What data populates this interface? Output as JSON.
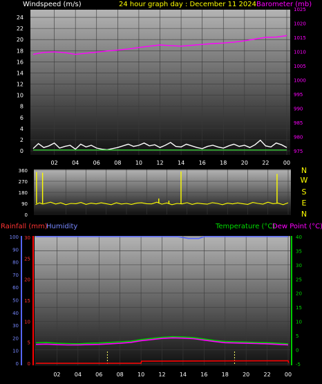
{
  "chart_data": [
    {
      "type": "line",
      "title": "24 hour graph day : December 11 2024",
      "left_axis_label": "Windspeed (m/s)",
      "right_axis_label": "Barometer (mb)",
      "x_ticks": [
        "02",
        "04",
        "06",
        "08",
        "10",
        "12",
        "14",
        "16",
        "18",
        "20",
        "22",
        "00"
      ],
      "left_ticks": [
        0,
        2,
        4,
        6,
        8,
        10,
        12,
        14,
        16,
        18,
        20,
        22,
        24
      ],
      "left_ylim": [
        0,
        25
      ],
      "right_ticks": [
        975,
        980,
        985,
        990,
        995,
        1000,
        1005,
        1010,
        1015,
        1020,
        1025
      ],
      "right_ylim": [
        974,
        1025
      ],
      "grid": true,
      "series": [
        {
          "axis": "right",
          "color": "#ff00ff",
          "x": [
            0,
            1,
            2,
            3,
            4,
            5,
            6,
            7,
            8,
            9,
            10,
            11,
            12,
            13,
            14,
            15,
            16,
            17,
            18,
            19,
            20,
            21,
            22,
            23,
            24
          ],
          "values": [
            1009.0,
            1009.7,
            1009.9,
            1009.6,
            1009.0,
            1009.4,
            1009.8,
            1010.2,
            1010.5,
            1010.9,
            1011.4,
            1011.9,
            1012.3,
            1012.1,
            1011.9,
            1012.2,
            1012.5,
            1012.8,
            1013.0,
            1013.3,
            1013.8,
            1014.4,
            1015.0,
            1015.1,
            1015.6
          ]
        },
        {
          "axis": "left",
          "color": "#ffffff",
          "x": [
            0,
            0.5,
            1,
            1.5,
            2,
            2.5,
            3,
            3.5,
            4,
            4.5,
            5,
            5.5,
            6,
            6.5,
            7,
            7.5,
            8,
            8.5,
            9,
            9.5,
            10,
            10.5,
            11,
            11.5,
            12,
            12.5,
            13,
            13.5,
            14,
            14.5,
            15,
            15.5,
            16,
            16.5,
            17,
            17.5,
            18,
            18.5,
            19,
            19.5,
            20,
            20.5,
            21,
            21.5,
            22,
            22.5,
            23,
            23.5,
            24
          ],
          "values": [
            0.4,
            1.3,
            0.6,
            0.9,
            1.4,
            0.5,
            0.8,
            1.0,
            0.3,
            1.2,
            0.7,
            1.0,
            0.5,
            0.3,
            0.2,
            0.4,
            0.6,
            0.9,
            1.2,
            0.8,
            1.0,
            1.4,
            0.9,
            1.1,
            0.6,
            1.0,
            1.5,
            0.8,
            0.7,
            1.2,
            0.9,
            0.6,
            0.4,
            0.8,
            1.0,
            0.7,
            0.5,
            0.9,
            1.2,
            0.8,
            1.0,
            0.6,
            1.1,
            1.9,
            0.9,
            0.7,
            1.4,
            1.1,
            0.6
          ]
        },
        {
          "axis": "left",
          "color": "#33cc33",
          "x": [
            0,
            24
          ],
          "values": [
            0.15,
            0.15
          ]
        }
      ]
    },
    {
      "type": "line",
      "y_ticks": [
        0,
        90,
        180,
        270,
        360
      ],
      "ylim": [
        0,
        360
      ],
      "compass_labels": [
        "N",
        "W",
        "S",
        "E",
        "N"
      ],
      "grid": true,
      "series": [
        {
          "color": "#ffff00",
          "x": [
            -1,
            -0.6,
            -0.3,
            0,
            0.5,
            1,
            1.5,
            2,
            2.5,
            3,
            3.5,
            4,
            4.5,
            5,
            5.5,
            6,
            6.5,
            7,
            7.5,
            8,
            8.5,
            9,
            9.5,
            10,
            10.5,
            11,
            11.5,
            12,
            12.5,
            13,
            13.5,
            14,
            14.5,
            15,
            15.5,
            16,
            16.5,
            17,
            17.5,
            18,
            18.5,
            19,
            19.5,
            20,
            20.5,
            21,
            21.5,
            22,
            22.5,
            23,
            23.5,
            24
          ],
          "values": [
            80,
            95,
            85,
            90,
            100,
            85,
            95,
            80,
            90,
            88,
            98,
            82,
            92,
            86,
            95,
            88,
            80,
            95,
            85,
            90,
            82,
            92,
            95,
            88,
            86,
            100,
            84,
            94,
            80,
            90,
            86,
            96,
            82,
            92,
            88,
            84,
            96,
            90,
            80,
            92,
            86,
            94,
            88,
            82,
            98,
            90,
            84,
            100,
            88,
            92,
            80,
            95
          ],
          "spikes": [
            {
              "x": -0.9,
              "value": 345
            },
            {
              "x": -0.3,
              "value": 340
            },
            {
              "x": 11.2,
              "value": 130
            },
            {
              "x": 12.2,
              "value": 112
            },
            {
              "x": 13.4,
              "value": 350
            },
            {
              "x": 22.9,
              "value": 330
            }
          ]
        }
      ]
    },
    {
      "type": "line",
      "left_label_1": "Rainfall (mm)",
      "left_label_2": "Humidity",
      "right_label_1": "Temperature (°C)",
      "right_label_2": "Dew Point (°C)",
      "x_ticks": [
        "02",
        "04",
        "06",
        "08",
        "10",
        "12",
        "14",
        "16",
        "18",
        "20",
        "22",
        "00"
      ],
      "humidity_ticks": [
        0,
        10,
        20,
        30,
        40,
        50,
        60,
        70,
        80,
        90,
        100
      ],
      "humidity_ylim": [
        0,
        100
      ],
      "rain_ticks": [
        0,
        5,
        10,
        15,
        20,
        25,
        30
      ],
      "rain_ylim": [
        0,
        30
      ],
      "temp_ticks": [
        -5,
        0,
        5,
        10,
        15,
        20,
        25,
        30,
        35,
        40
      ],
      "temp_ylim": [
        -6,
        40
      ],
      "grid": true,
      "series": [
        {
          "name": "Humidity",
          "axis": "humidity",
          "color": "#5566ff",
          "x": [
            0,
            4,
            8,
            12,
            13.5,
            14.5,
            15.5,
            16,
            20,
            24
          ],
          "values": [
            100,
            100,
            100,
            100,
            100,
            98.5,
            98.5,
            100,
            100,
            100
          ]
        },
        {
          "name": "Temperature (°C)",
          "axis": "temp",
          "color": "#00cc00",
          "x": [
            0,
            1,
            2,
            3,
            4,
            5,
            6,
            7,
            8,
            9,
            10,
            11,
            12,
            13,
            14,
            15,
            16,
            17,
            18,
            19,
            20,
            21,
            22,
            23,
            24
          ],
          "values": [
            2.5,
            2.6,
            2.3,
            2.2,
            2.1,
            2.3,
            2.4,
            2.6,
            2.8,
            3.0,
            3.6,
            4.0,
            4.4,
            4.6,
            4.5,
            4.3,
            3.8,
            3.3,
            2.9,
            2.8,
            2.7,
            2.6,
            2.5,
            2.3,
            2.1
          ]
        },
        {
          "name": "Dew Point (°C)",
          "axis": "temp",
          "color": "#ff00ff",
          "x": [
            0,
            1,
            2,
            3,
            4,
            5,
            6,
            7,
            8,
            9,
            10,
            11,
            12,
            13,
            14,
            15,
            16,
            17,
            18,
            19,
            20,
            21,
            22,
            23,
            24
          ],
          "values": [
            1.9,
            2.0,
            1.8,
            1.7,
            1.7,
            1.8,
            1.9,
            2.1,
            2.3,
            2.6,
            3.2,
            3.6,
            4.0,
            4.2,
            4.1,
            3.9,
            3.4,
            2.9,
            2.5,
            2.4,
            2.3,
            2.2,
            2.1,
            1.9,
            1.7
          ]
        },
        {
          "name": "Rainfall (mm)",
          "axis": "rain",
          "color": "#ff0000",
          "x": [
            0,
            10,
            10.05,
            24,
            24.05
          ],
          "values": [
            0,
            0,
            0.5,
            0.6,
            0.1
          ]
        }
      ],
      "markers": [
        6.8,
        18.9
      ]
    }
  ]
}
